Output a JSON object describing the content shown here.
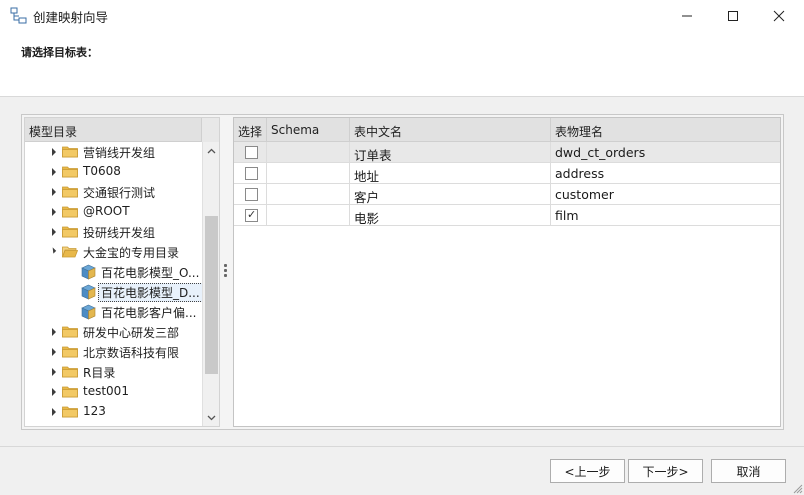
{
  "window": {
    "title": "创建映射向导",
    "controls": {
      "minimize": "minimize-icon",
      "maximize": "maximize-icon",
      "close": "close-icon"
    }
  },
  "header": {
    "subtitle": "请选择目标表："
  },
  "tree": {
    "header": "模型目录",
    "items": [
      {
        "label": "营销线开发组",
        "type": "folder",
        "level": 0,
        "expanded": false
      },
      {
        "label": "T0608",
        "type": "folder",
        "level": 0,
        "expanded": false
      },
      {
        "label": "交通银行测试",
        "type": "folder",
        "level": 0,
        "expanded": false
      },
      {
        "label": "@ROOT",
        "type": "folder",
        "level": 0,
        "expanded": false
      },
      {
        "label": "投研线开发组",
        "type": "folder",
        "level": 0,
        "expanded": false
      },
      {
        "label": "大金宝的专用目录",
        "type": "folder",
        "level": 0,
        "expanded": true
      },
      {
        "label": "百花电影模型_O...",
        "type": "model",
        "level": 1
      },
      {
        "label": "百花电影模型_D...",
        "type": "model",
        "level": 1,
        "selected": true
      },
      {
        "label": "百花电影客户偏...",
        "type": "model",
        "level": 1
      },
      {
        "label": "研发中心研发三部",
        "type": "folder",
        "level": 0,
        "expanded": false
      },
      {
        "label": "北京数语科技有限",
        "type": "folder",
        "level": 0,
        "expanded": false
      },
      {
        "label": "R目录",
        "type": "folder",
        "level": 0,
        "expanded": false
      },
      {
        "label": "test001",
        "type": "folder",
        "level": 0,
        "expanded": false
      },
      {
        "label": "123",
        "type": "folder",
        "level": 0,
        "expanded": false
      }
    ]
  },
  "grid": {
    "columns": [
      "选择",
      "Schema",
      "表中文名",
      "表物理名"
    ],
    "rows": [
      {
        "checked": false,
        "schema": "",
        "cn_name": "订单表",
        "physical_name": "dwd_ct_orders"
      },
      {
        "checked": false,
        "schema": "",
        "cn_name": "地址",
        "physical_name": "address"
      },
      {
        "checked": false,
        "schema": "",
        "cn_name": "客户",
        "physical_name": "customer"
      },
      {
        "checked": true,
        "schema": "",
        "cn_name": "电影",
        "physical_name": "film"
      }
    ]
  },
  "buttons": {
    "prev": "<上一步",
    "next": "下一步>",
    "cancel": "取消"
  },
  "colors": {
    "folder": "#e8b84a",
    "cube_top": "#6ba7d6",
    "cube_side": "#e3b74f"
  }
}
